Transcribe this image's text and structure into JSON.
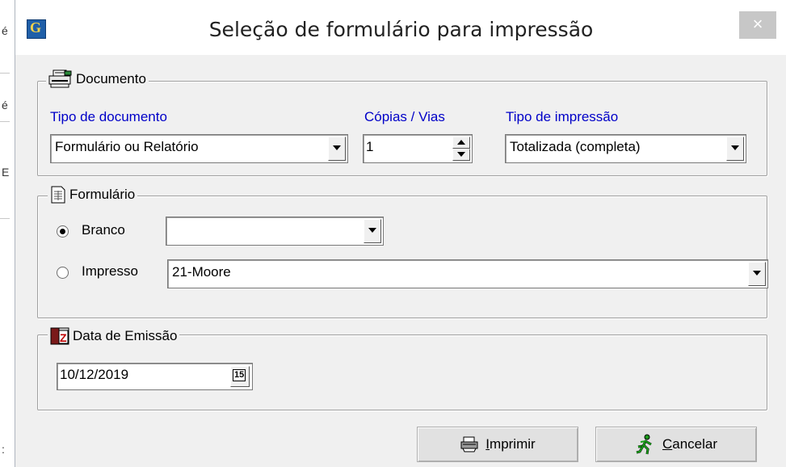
{
  "window": {
    "title": "Seleção de formulário para impressão",
    "close_label": "×",
    "app_icon_letter": "G"
  },
  "documento": {
    "group_label": "Documento",
    "tipo_label": "Tipo de documento",
    "tipo_value": "Formulário ou Relatório",
    "copias_label": "Cópias / Vias",
    "copias_value": "1",
    "impressao_label": "Tipo de impressão",
    "impressao_value": "Totalizada (completa)"
  },
  "formulario": {
    "group_label": "Formulário",
    "branco_label": "Branco",
    "branco_selected": true,
    "branco_value": "",
    "impresso_label": "Impresso",
    "impresso_selected": false,
    "impresso_value": "21-Moore"
  },
  "data_emissao": {
    "group_label": "Data de Emissão",
    "date_value": "10/12/2019",
    "calendar_day": "15",
    "calendar_badge": "Z"
  },
  "buttons": {
    "imprimir_first": "I",
    "imprimir_rest": "mprimir",
    "cancelar_first": "C",
    "cancelar_rest": "ancelar"
  },
  "background_chars": [
    "é",
    "é",
    "E",
    ":"
  ]
}
